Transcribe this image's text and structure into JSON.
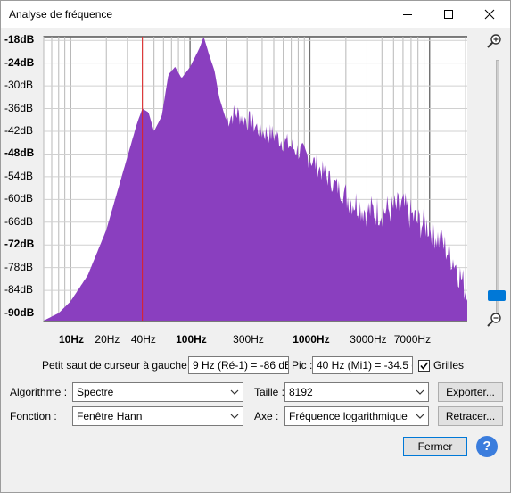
{
  "window": {
    "title": "Analyse de fréquence",
    "controls": {
      "minimize": "minimize-icon",
      "maximize": "maximize-icon",
      "close": "close-icon"
    }
  },
  "spectrum": {
    "y_labels": [
      {
        "text": "-18dB",
        "bold": true
      },
      {
        "text": "-24dB",
        "bold": true
      },
      {
        "text": "-30dB",
        "bold": false
      },
      {
        "text": "-36dB",
        "bold": false
      },
      {
        "text": "-42dB",
        "bold": false
      },
      {
        "text": "-48dB",
        "bold": true
      },
      {
        "text": "-54dB",
        "bold": false
      },
      {
        "text": "-60dB",
        "bold": false
      },
      {
        "text": "-66dB",
        "bold": false
      },
      {
        "text": "-72dB",
        "bold": true
      },
      {
        "text": "-78dB",
        "bold": false
      },
      {
        "text": "-84dB",
        "bold": false
      },
      {
        "text": "-90dB",
        "bold": true
      }
    ],
    "x_labels": [
      {
        "text": "10Hz",
        "bold": true,
        "hz": 10
      },
      {
        "text": "20Hz",
        "bold": false,
        "hz": 20
      },
      {
        "text": "40Hz",
        "bold": false,
        "hz": 40
      },
      {
        "text": "100Hz",
        "bold": true,
        "hz": 100
      },
      {
        "text": "300Hz",
        "bold": false,
        "hz": 300
      },
      {
        "text": "1000Hz",
        "bold": true,
        "hz": 1000
      },
      {
        "text": "3000Hz",
        "bold": false,
        "hz": 3000
      },
      {
        "text": "7000Hz",
        "bold": false,
        "hz": 7000
      }
    ],
    "cursor_hz": 40,
    "fill_color": "#8a3fbf",
    "cursor_color": "#e02020",
    "zoom_in_icon": "zoom-in-icon",
    "zoom_out_icon": "zoom-out-icon"
  },
  "cursor_info": {
    "label": "Petit saut de curseur à gauche :",
    "value": "9 Hz (Ré-1) = -86 dB",
    "peak_label": "Pic :",
    "peak_value": "40 Hz (Mi1) = -34.5 dB",
    "grids_label": "Grilles",
    "grids_checked": true
  },
  "controls": {
    "algorithm_label": "Algorithme :",
    "algorithm_value": "Spectre",
    "size_label": "Taille :",
    "size_value": "8192",
    "export_button": "Exporter...",
    "function_label": "Fonction :",
    "function_value": "Fenêtre Hann",
    "axis_label": "Axe :",
    "axis_value": "Fréquence logarithmique",
    "replot_button": "Retracer...",
    "close_button": "Fermer",
    "help_button": "?"
  }
}
